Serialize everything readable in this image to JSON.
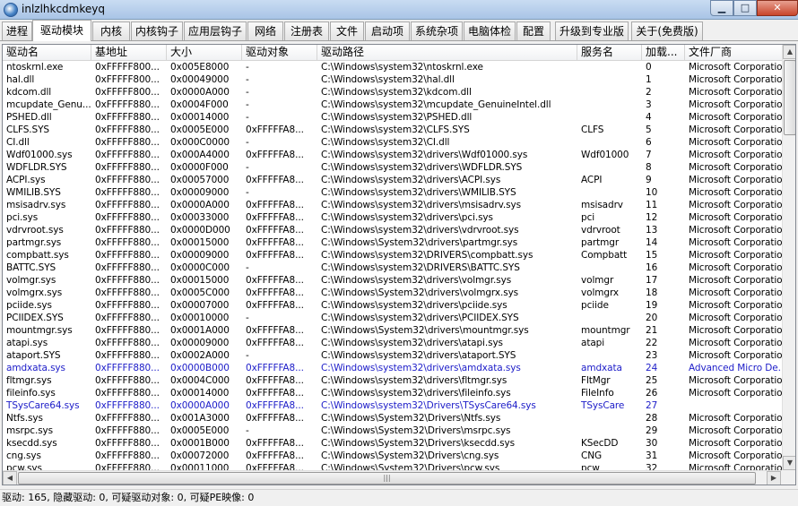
{
  "window": {
    "title": "inlzlhkcdmkeyq",
    "minimize": "▁",
    "maximize": "□",
    "close": "✕"
  },
  "tabs": [
    {
      "label": "进程"
    },
    {
      "label": "驱动模块",
      "active": true
    },
    {
      "label": "内核"
    },
    {
      "label": "内核钩子"
    },
    {
      "label": "应用层钩子"
    },
    {
      "label": "网络"
    },
    {
      "label": "注册表"
    },
    {
      "label": "文件"
    },
    {
      "label": "启动项"
    },
    {
      "label": "系统杂项"
    },
    {
      "label": "电脑体检"
    },
    {
      "label": "配置"
    },
    {
      "label": "升级到专业版"
    },
    {
      "label": "关于(免费版)"
    }
  ],
  "table": {
    "columns": [
      "驱动名",
      "基地址",
      "大小",
      "驱动对象",
      "驱动路径",
      "服务名",
      "加载...",
      "文件厂商"
    ],
    "rows": [
      [
        "ntoskrnl.exe",
        "0xFFFFF800...",
        "0x005E8000",
        "-",
        "C:\\Windows\\system32\\ntoskrnl.exe",
        "",
        "0",
        "Microsoft Corporation"
      ],
      [
        "hal.dll",
        "0xFFFFF800...",
        "0x00049000",
        "-",
        "C:\\Windows\\system32\\hal.dll",
        "",
        "1",
        "Microsoft Corporation"
      ],
      [
        "kdcom.dll",
        "0xFFFFF800...",
        "0x0000A000",
        "-",
        "C:\\Windows\\system32\\kdcom.dll",
        "",
        "2",
        "Microsoft Corporation"
      ],
      [
        "mcupdate_Genu...",
        "0xFFFFF880...",
        "0x0004F000",
        "-",
        "C:\\Windows\\system32\\mcupdate_GenuineIntel.dll",
        "",
        "3",
        "Microsoft Corporation"
      ],
      [
        "PSHED.dll",
        "0xFFFFF880...",
        "0x00014000",
        "-",
        "C:\\Windows\\system32\\PSHED.dll",
        "",
        "4",
        "Microsoft Corporation"
      ],
      [
        "CLFS.SYS",
        "0xFFFFF880...",
        "0x0005E000",
        "0xFFFFFA8...",
        "C:\\Windows\\system32\\CLFS.SYS",
        "CLFS",
        "5",
        "Microsoft Corporation"
      ],
      [
        "CI.dll",
        "0xFFFFF880...",
        "0x000C0000",
        "-",
        "C:\\Windows\\system32\\CI.dll",
        "",
        "6",
        "Microsoft Corporation"
      ],
      [
        "Wdf01000.sys",
        "0xFFFFF880...",
        "0x000A4000",
        "0xFFFFFA8...",
        "C:\\Windows\\system32\\drivers\\Wdf01000.sys",
        "Wdf01000",
        "7",
        "Microsoft Corporation"
      ],
      [
        "WDFLDR.SYS",
        "0xFFFFF880...",
        "0x0000F000",
        "-",
        "C:\\Windows\\system32\\drivers\\WDFLDR.SYS",
        "",
        "8",
        "Microsoft Corporation"
      ],
      [
        "ACPI.sys",
        "0xFFFFF880...",
        "0x00057000",
        "0xFFFFFA8...",
        "C:\\Windows\\system32\\drivers\\ACPI.sys",
        "ACPI",
        "9",
        "Microsoft Corporation"
      ],
      [
        "WMILIB.SYS",
        "0xFFFFF880...",
        "0x00009000",
        "-",
        "C:\\Windows\\system32\\drivers\\WMILIB.SYS",
        "",
        "10",
        "Microsoft Corporation"
      ],
      [
        "msisadrv.sys",
        "0xFFFFF880...",
        "0x0000A000",
        "0xFFFFFA8...",
        "C:\\Windows\\system32\\drivers\\msisadrv.sys",
        "msisadrv",
        "11",
        "Microsoft Corporation"
      ],
      [
        "pci.sys",
        "0xFFFFF880...",
        "0x00033000",
        "0xFFFFFA8...",
        "C:\\Windows\\system32\\drivers\\pci.sys",
        "pci",
        "12",
        "Microsoft Corporation"
      ],
      [
        "vdrvroot.sys",
        "0xFFFFF880...",
        "0x0000D000",
        "0xFFFFFA8...",
        "C:\\Windows\\system32\\drivers\\vdrvroot.sys",
        "vdrvroot",
        "13",
        "Microsoft Corporation"
      ],
      [
        "partmgr.sys",
        "0xFFFFF880...",
        "0x00015000",
        "0xFFFFFA8...",
        "C:\\Windows\\System32\\drivers\\partmgr.sys",
        "partmgr",
        "14",
        "Microsoft Corporation"
      ],
      [
        "compbatt.sys",
        "0xFFFFF880...",
        "0x00009000",
        "0xFFFFFA8...",
        "C:\\Windows\\system32\\DRIVERS\\compbatt.sys",
        "Compbatt",
        "15",
        "Microsoft Corporation"
      ],
      [
        "BATTC.SYS",
        "0xFFFFF880...",
        "0x0000C000",
        "-",
        "C:\\Windows\\system32\\DRIVERS\\BATTC.SYS",
        "",
        "16",
        "Microsoft Corporation"
      ],
      [
        "volmgr.sys",
        "0xFFFFF880...",
        "0x00015000",
        "0xFFFFFA8...",
        "C:\\Windows\\system32\\drivers\\volmgr.sys",
        "volmgr",
        "17",
        "Microsoft Corporation"
      ],
      [
        "volmgrx.sys",
        "0xFFFFF880...",
        "0x0005C000",
        "0xFFFFFA8...",
        "C:\\Windows\\System32\\drivers\\volmgrx.sys",
        "volmgrx",
        "18",
        "Microsoft Corporation"
      ],
      [
        "pciide.sys",
        "0xFFFFF880...",
        "0x00007000",
        "0xFFFFFA8...",
        "C:\\Windows\\system32\\drivers\\pciide.sys",
        "pciide",
        "19",
        "Microsoft Corporation"
      ],
      [
        "PCIIDEX.SYS",
        "0xFFFFF880...",
        "0x00010000",
        "-",
        "C:\\Windows\\system32\\drivers\\PCIIDEX.SYS",
        "",
        "20",
        "Microsoft Corporation"
      ],
      [
        "mountmgr.sys",
        "0xFFFFF880...",
        "0x0001A000",
        "0xFFFFFA8...",
        "C:\\Windows\\System32\\drivers\\mountmgr.sys",
        "mountmgr",
        "21",
        "Microsoft Corporation"
      ],
      [
        "atapi.sys",
        "0xFFFFF880...",
        "0x00009000",
        "0xFFFFFA8...",
        "C:\\Windows\\system32\\drivers\\atapi.sys",
        "atapi",
        "22",
        "Microsoft Corporation"
      ],
      [
        "ataport.SYS",
        "0xFFFFF880...",
        "0x0002A000",
        "-",
        "C:\\Windows\\system32\\drivers\\ataport.SYS",
        "",
        "23",
        "Microsoft Corporation"
      ],
      [
        "amdxata.sys",
        "0xFFFFF880...",
        "0x0000B000",
        "0xFFFFFA8...",
        "C:\\Windows\\system32\\drivers\\amdxata.sys",
        "amdxata",
        "24",
        "Advanced Micro De...",
        "blue"
      ],
      [
        "fltmgr.sys",
        "0xFFFFF880...",
        "0x0004C000",
        "0xFFFFFA8...",
        "C:\\Windows\\system32\\drivers\\fltmgr.sys",
        "FltMgr",
        "25",
        "Microsoft Corporation"
      ],
      [
        "fileinfo.sys",
        "0xFFFFF880...",
        "0x00014000",
        "0xFFFFFA8...",
        "C:\\Windows\\system32\\drivers\\fileinfo.sys",
        "FileInfo",
        "26",
        "Microsoft Corporation"
      ],
      [
        "TSysCare64.sys",
        "0xFFFFF880...",
        "0x0000A000",
        "0xFFFFFA8...",
        "C:\\Windows\\system32\\Drivers\\TSysCare64.sys",
        "TSysCare",
        "27",
        "",
        "blue"
      ],
      [
        "Ntfs.sys",
        "0xFFFFF880...",
        "0x001A3000",
        "0xFFFFFA8...",
        "C:\\Windows\\System32\\Drivers\\Ntfs.sys",
        "",
        "28",
        "Microsoft Corporation"
      ],
      [
        "msrpc.sys",
        "0xFFFFF880...",
        "0x0005E000",
        "-",
        "C:\\Windows\\System32\\Drivers\\msrpc.sys",
        "",
        "29",
        "Microsoft Corporation"
      ],
      [
        "ksecdd.sys",
        "0xFFFFF880...",
        "0x0001B000",
        "0xFFFFFA8...",
        "C:\\Windows\\System32\\Drivers\\ksecdd.sys",
        "KSecDD",
        "30",
        "Microsoft Corporation"
      ],
      [
        "cng.sys",
        "0xFFFFF880...",
        "0x00072000",
        "0xFFFFFA8...",
        "C:\\Windows\\System32\\Drivers\\cng.sys",
        "CNG",
        "31",
        "Microsoft Corporation"
      ],
      [
        "pcw.sys",
        "0xFFFFF880...",
        "0x00011000",
        "0xFFFFFA8...",
        "C:\\Windows\\System32\\Drivers\\pcw.sys",
        "pcw",
        "32",
        "Microsoft Corporation"
      ]
    ]
  },
  "scroll": {
    "up": "▲",
    "down": "▼",
    "left": "◀",
    "right": "▶",
    "grip": "|||"
  },
  "status": {
    "text": "驱动: 165, 隐藏驱动: 0, 可疑驱动对象: 0, 可疑PE映像: 0"
  },
  "colors": {
    "highlight_row_text": "#1c1cc8"
  }
}
